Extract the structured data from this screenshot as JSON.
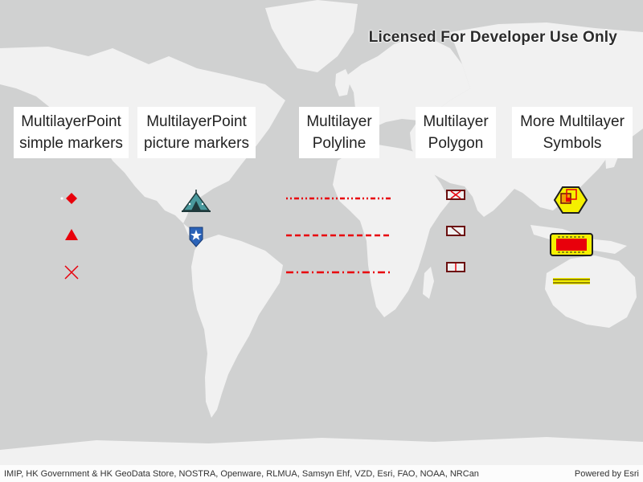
{
  "watermark": "Licensed For Developer Use Only",
  "labels": {
    "simple_markers": [
      "MultilayerPoint",
      "simple markers"
    ],
    "picture_markers": [
      "MultilayerPoint",
      "picture markers"
    ],
    "polyline": [
      "Multilayer",
      "Polyline"
    ],
    "polygon": [
      "Multilayer",
      "Polygon"
    ],
    "more_symbols": [
      "More Multilayer",
      "Symbols"
    ]
  },
  "attribution": {
    "sources": "IMIP, HK Government & HK GeoData Store, NOSTRA, Openware, RLMUA, Samsyn Ehf, VZD, Esri, FAO, NOAA, NRCan",
    "powered_by": "Powered by Esri"
  },
  "colors": {
    "ocean": "#d0d1d1",
    "land": "#f1f1f1",
    "symbol_red": "#e8000b",
    "symbol_yellow": "#f5f000",
    "outline_dark": "#6b0f0f"
  },
  "symbols": {
    "simple_markers": [
      "diamond",
      "triangle",
      "x"
    ],
    "picture_markers": [
      "tent-icon",
      "pin-star-icon"
    ],
    "polylines": [
      "short-dash-dot-dot",
      "dash",
      "dash-dot"
    ],
    "polygons": [
      "diagonal-cross-fill",
      "forward-diagonal-fill",
      "vertical-fill"
    ],
    "more": [
      "hexagon-marker",
      "complex-rectangle",
      "yellow-line"
    ]
  }
}
